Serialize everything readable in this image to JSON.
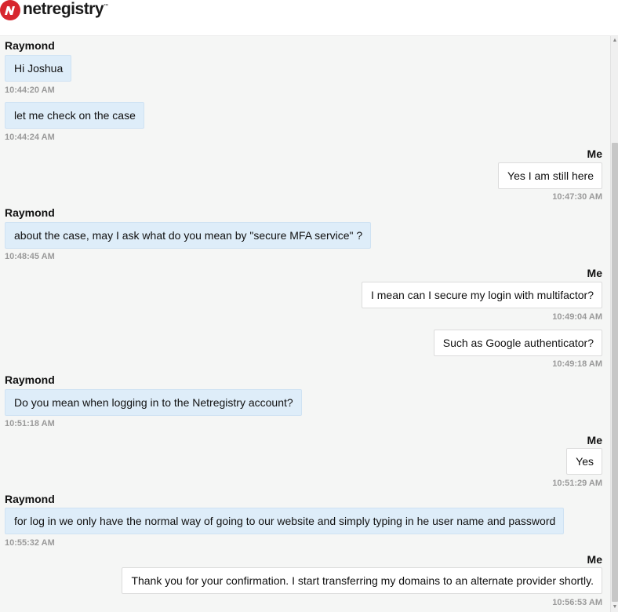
{
  "brand": {
    "name": "netregistry",
    "trademark": "™"
  },
  "messages": [
    {
      "sender": "Raymond",
      "text": "Hi Joshua",
      "time": "10:44:20 AM"
    },
    {
      "sender": "",
      "text": "let me check on the case",
      "time": "10:44:24 AM"
    },
    {
      "sender": "Me",
      "text": "Yes I am still here",
      "time": "10:47:30 AM"
    },
    {
      "sender": "Raymond",
      "text": "about the case, may I ask what do you mean by \"secure MFA service\" ?",
      "time": "10:48:45 AM"
    },
    {
      "sender": "Me",
      "text": "I mean can I secure my login with multifactor?",
      "time": "10:49:04 AM"
    },
    {
      "sender": "",
      "text": "Such as Google authenticator?",
      "time": "10:49:18 AM"
    },
    {
      "sender": "Raymond",
      "text": "Do you mean when logging in to the Netregistry account?",
      "time": "10:51:18 AM"
    },
    {
      "sender": "Me",
      "text": "Yes",
      "time": "10:51:29 AM"
    },
    {
      "sender": "Raymond",
      "text": "for log in we only have the normal way of going to our website and simply typing in he user name and password",
      "time": "10:55:32 AM"
    },
    {
      "sender": "Me",
      "text": "Thank you for your confirmation. I start transferring my domains to an alternate provider shortly.",
      "time": "10:56:53 AM"
    }
  ],
  "scrollbar": {
    "up_icon": "▲",
    "down_icon": "▼"
  }
}
